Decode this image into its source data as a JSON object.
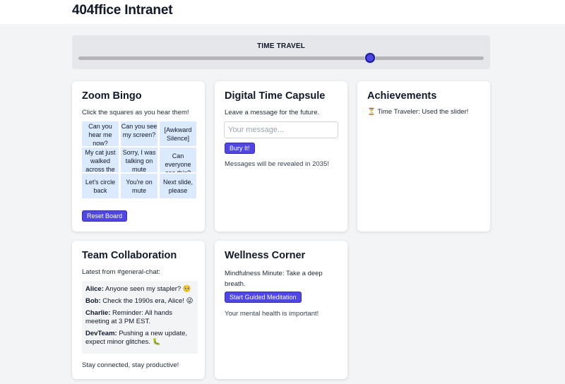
{
  "header": {
    "title": "404ffice Intranet"
  },
  "time_travel": {
    "label": "TIME TRAVEL",
    "value_percent": 72
  },
  "bingo": {
    "title": "Zoom Bingo",
    "instruction": "Click the squares as you hear them!",
    "cells": [
      "Can you hear me now?",
      "Can you see my screen?",
      "[Awkward Silence]",
      "My cat just walked across the keyboard",
      "Sorry, I was talking on mute",
      "Can everyone see this?",
      "Let's circle back",
      "You're on mute",
      "Next slide, please"
    ],
    "reset_label": "Reset Board"
  },
  "capsule": {
    "title": "Digital Time Capsule",
    "instruction": "Leave a message for the future.",
    "placeholder": "Your message...",
    "value": "",
    "bury_label": "Bury It!",
    "note": "Messages will be revealed in 2035!"
  },
  "achievements": {
    "title": "Achievements",
    "items": [
      {
        "icon": "hourglass-icon",
        "emoji": "⏳",
        "text": "Time Traveler: Used the slider!"
      }
    ]
  },
  "team": {
    "title": "Team Collaboration",
    "source": "Latest from #general-chat:",
    "messages": [
      {
        "author": "Alice:",
        "text": "Anyone seen my stapler? 🥺"
      },
      {
        "author": "Bob:",
        "text": "Check the 1990s era, Alice! 😜"
      },
      {
        "author": "Charlie:",
        "text": "Reminder: All hands meeting at 3 PM EST."
      },
      {
        "author": "DevTeam:",
        "text": "Pushing a new update, expect minor glitches. 🐛"
      }
    ],
    "footer": "Stay connected, stay productive!"
  },
  "wellness": {
    "title": "Wellness Corner",
    "tip": "Mindfulness Minute: Take a deep breath.",
    "button_label": "Start Guided Meditation",
    "footer": "Your mental health is important!"
  },
  "colors": {
    "accent": "#4f46e5",
    "bingo_cell": "#dbeafe",
    "page_bg": "#f3f4f6"
  }
}
